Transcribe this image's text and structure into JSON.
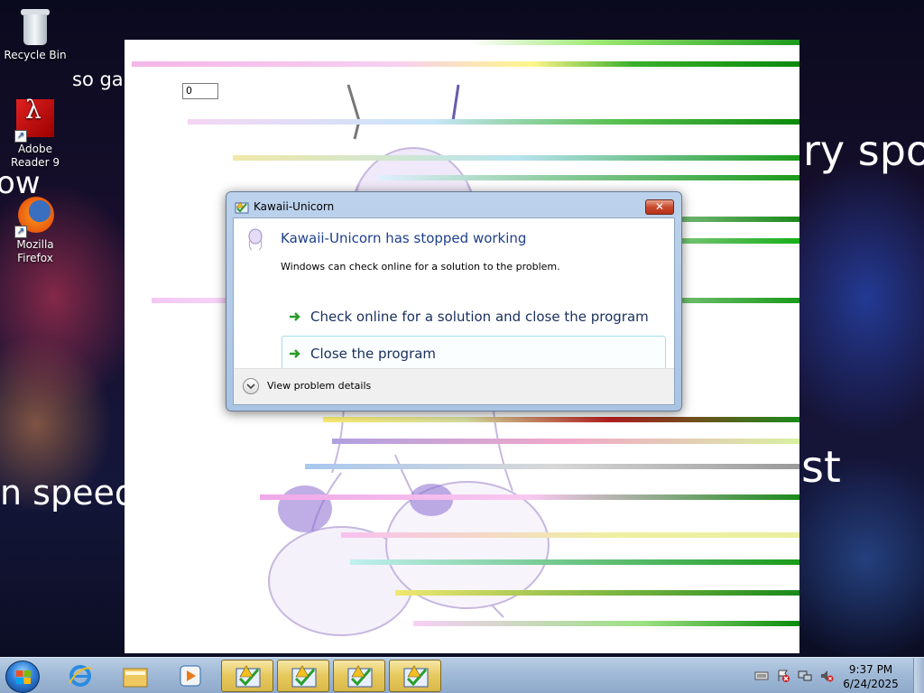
{
  "wallpaper_text": [
    "so gal",
    "ow",
    "ry spo",
    "n speed",
    "st"
  ],
  "desktop_icons": [
    {
      "label": "Recycle Bin",
      "icon": "recycle-bin-icon"
    },
    {
      "label": "Adobe Reader 9",
      "icon": "adobe-reader-icon"
    },
    {
      "label": "Mozilla Firefox",
      "icon": "firefox-icon"
    }
  ],
  "app_window": {
    "input_value": "0"
  },
  "dialog": {
    "title": "Kawaii-Unicorn",
    "heading": "Kawaii-Unicorn has stopped working",
    "subtext": "Windows can check online for a solution to the problem.",
    "options": [
      {
        "label": "Check online for a solution and close the program",
        "icon": "green-arrow-icon"
      },
      {
        "label": "Close the program",
        "icon": "green-arrow-icon"
      }
    ],
    "details_label": "View problem details",
    "close_label": "✕"
  },
  "taskbar": {
    "pinned": [
      {
        "name": "internet-explorer",
        "icon": "ie-icon"
      },
      {
        "name": "windows-explorer",
        "icon": "folder-icon"
      },
      {
        "name": "media-player",
        "icon": "media-player-icon"
      }
    ],
    "running_count": 4,
    "running_icon": "warning-check-icon",
    "clock_time": "9:37 PM",
    "clock_date": "6/24/2025"
  },
  "colors": {
    "dialog_heading": "#1e3f8c",
    "taskbar": "#9fb8d6",
    "active_button": "#e6c85c"
  }
}
